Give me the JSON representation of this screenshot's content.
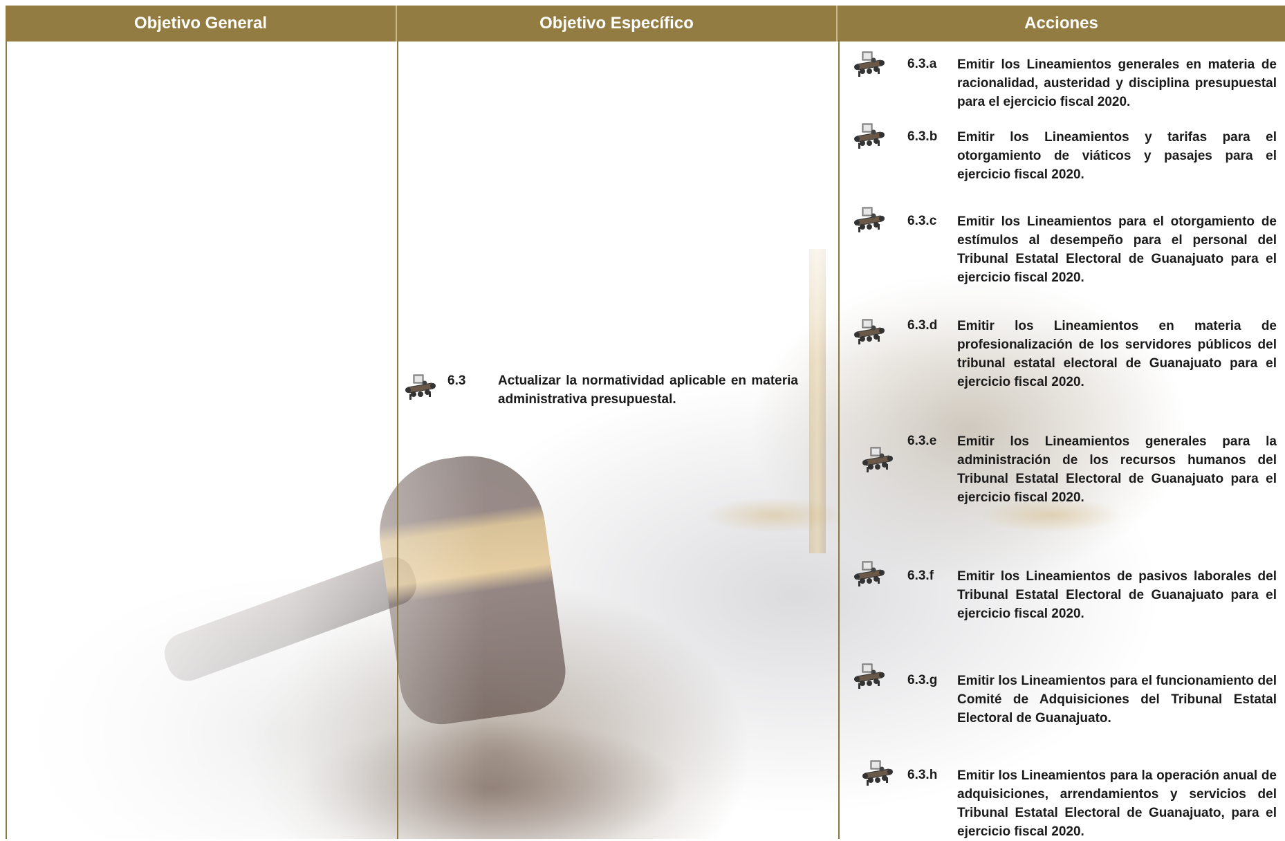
{
  "header": {
    "col1": "Objetivo General",
    "col2": "Objetivo Específico",
    "col3": "Acciones"
  },
  "specific": {
    "number": "6.3",
    "text": "Actualizar la normatividad aplicable en materia administrativa presupuestal."
  },
  "actions": [
    {
      "id": "6.3.a",
      "text": "Emitir los Lineamientos generales en materia de racionalidad, austeridad y disciplina presupuestal para el ejercicio fiscal 2020."
    },
    {
      "id": "6.3.b",
      "text": "Emitir los Lineamientos y tarifas para el otorgamiento de viáticos y pasajes para el ejercicio fiscal 2020."
    },
    {
      "id": "6.3.c",
      "text": "Emitir los Lineamientos para el otorgamiento de estímulos al desempeño para el personal del Tribunal Estatal Electoral de Guanajuato para el ejercicio fiscal 2020."
    },
    {
      "id": "6.3.d",
      "text": "Emitir los Lineamientos en materia de profesionalización de los servidores públicos del tribunal estatal electoral de Guanajuato para el ejercicio fiscal 2020."
    },
    {
      "id": "6.3.e",
      "text": "Emitir los Lineamientos generales para la administración de los recursos humanos del Tribunal Estatal Electoral de Guanajuato para el ejercicio fiscal 2020."
    },
    {
      "id": "6.3.f",
      "text": "Emitir los Lineamientos de pasivos laborales del Tribunal Estatal Electoral de Guanajuato para el ejercicio fiscal 2020."
    },
    {
      "id": "6.3.g",
      "text": "Emitir los Lineamientos para el funcionamiento del Comité de Adquisiciones del Tribunal Estatal Electoral de Guanajuato."
    },
    {
      "id": "6.3.h",
      "text": "Emitir los Lineamientos para la operación anual de adquisiciones, arrendamientos y servicios del Tribunal Estatal Electoral de Guanajuato, para el ejercicio fiscal 2020."
    }
  ],
  "colors": {
    "header_bg": "#927c42",
    "header_text": "#ffffff",
    "body_text": "#1a1a1a"
  },
  "icon": "meeting-table-icon"
}
